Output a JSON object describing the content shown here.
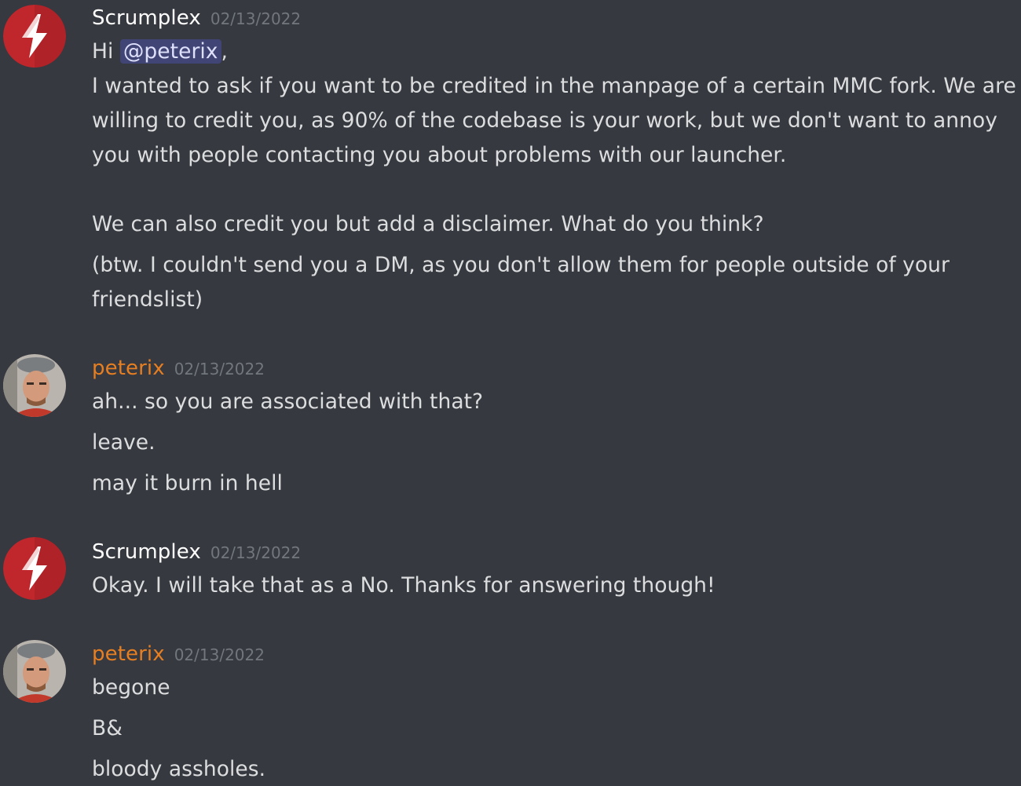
{
  "messages": [
    {
      "author": "Scrumplex",
      "timestamp": "02/13/2022",
      "greeting_prefix": "Hi ",
      "mention": "@peterix",
      "greeting_suffix": ",",
      "paragraph1": [
        "I wanted to ask if you want to be credited in the manpage of a certain MMC fork. We are",
        "willing to credit you, as 90% of the codebase is your work, but we don't want to annoy",
        "you with people contacting you about problems with our launcher."
      ],
      "paragraph2": "We can also credit you but add a disclaimer. What do you think?",
      "followup": [
        "(btw. I couldn't send you a DM, as you don't allow them for people outside of your",
        "friendslist)"
      ]
    },
    {
      "author": "peterix",
      "timestamp": "02/13/2022",
      "lines": [
        "ah... so you are associated with that?",
        "leave.",
        "may it burn in hell"
      ]
    },
    {
      "author": "Scrumplex",
      "timestamp": "02/13/2022",
      "lines": [
        "Okay. I will take that as a No. Thanks for answering though!"
      ]
    },
    {
      "author": "peterix",
      "timestamp": "02/13/2022",
      "lines": [
        "begone",
        "B&",
        "bloody assholes."
      ]
    }
  ],
  "colors": {
    "background": "#36393f",
    "text": "#dcddde",
    "timestamp": "#72767d",
    "author_orange": "#e67e22",
    "scrumplex_avatar": "#c62828"
  },
  "icons": {
    "scrumplex_avatar": "lightning-logo-icon",
    "peterix_avatar": "person-photo-avatar"
  }
}
